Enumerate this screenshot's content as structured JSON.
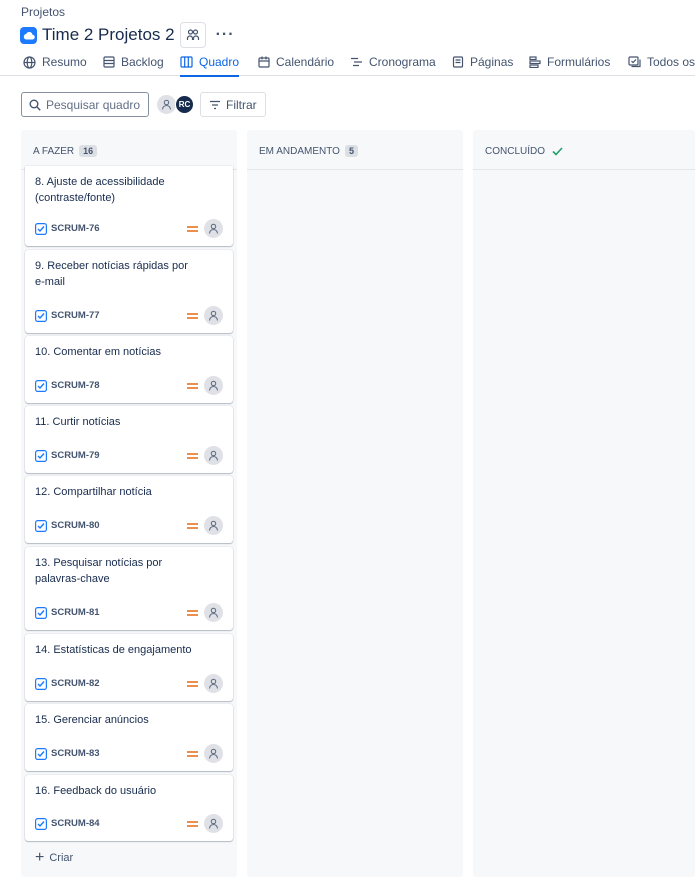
{
  "breadcrumb": "Projetos",
  "project": {
    "title": "Time 2 Projetos 2",
    "icon": "cloud-project-icon"
  },
  "tabs": [
    {
      "label": "Resumo",
      "icon": "globe-icon"
    },
    {
      "label": "Backlog",
      "icon": "backlog-icon"
    },
    {
      "label": "Quadro",
      "icon": "board-icon",
      "active": true
    },
    {
      "label": "Calendário",
      "icon": "calendar-icon"
    },
    {
      "label": "Cronograma",
      "icon": "timeline-icon"
    },
    {
      "label": "Páginas",
      "icon": "page-icon"
    },
    {
      "label": "Formulários",
      "icon": "form-icon"
    },
    {
      "label": "Todos os",
      "icon": "issues-icon"
    }
  ],
  "toolbar": {
    "search_placeholder": "Pesquisar quadro",
    "avatar_initials": "RC",
    "filter_label": "Filtrar"
  },
  "columns": [
    {
      "title": "A FAZER",
      "count": "16"
    },
    {
      "title": "EM ANDAMENTO",
      "count": "5"
    },
    {
      "title": "CONCLUÍDO",
      "done_icon": "check-icon"
    }
  ],
  "cards": [
    {
      "title": "8. Ajuste de acessibilidade (contraste/fonte)",
      "key": "SCRUM-76"
    },
    {
      "title": "9. Receber notícias rápidas por e-mail",
      "key": "SCRUM-77"
    },
    {
      "title": "10. Comentar em notícias",
      "key": "SCRUM-78"
    },
    {
      "title": "11. Curtir notícias",
      "key": "SCRUM-79"
    },
    {
      "title": "12. Compartilhar notícia",
      "key": "SCRUM-80"
    },
    {
      "title": "13. Pesquisar notícias por palavras-chave",
      "key": "SCRUM-81"
    },
    {
      "title": "14. Estatísticas de engajamento",
      "key": "SCRUM-82"
    },
    {
      "title": "15. Gerenciar anúncios",
      "key": "SCRUM-83"
    },
    {
      "title": "16. Feedback do usuário",
      "key": "SCRUM-84"
    }
  ],
  "create_label": "Criar",
  "colors": {
    "accent": "#0c66e4",
    "priority": "#e56910",
    "story": "#1d7afc",
    "done": "#22a06b"
  }
}
